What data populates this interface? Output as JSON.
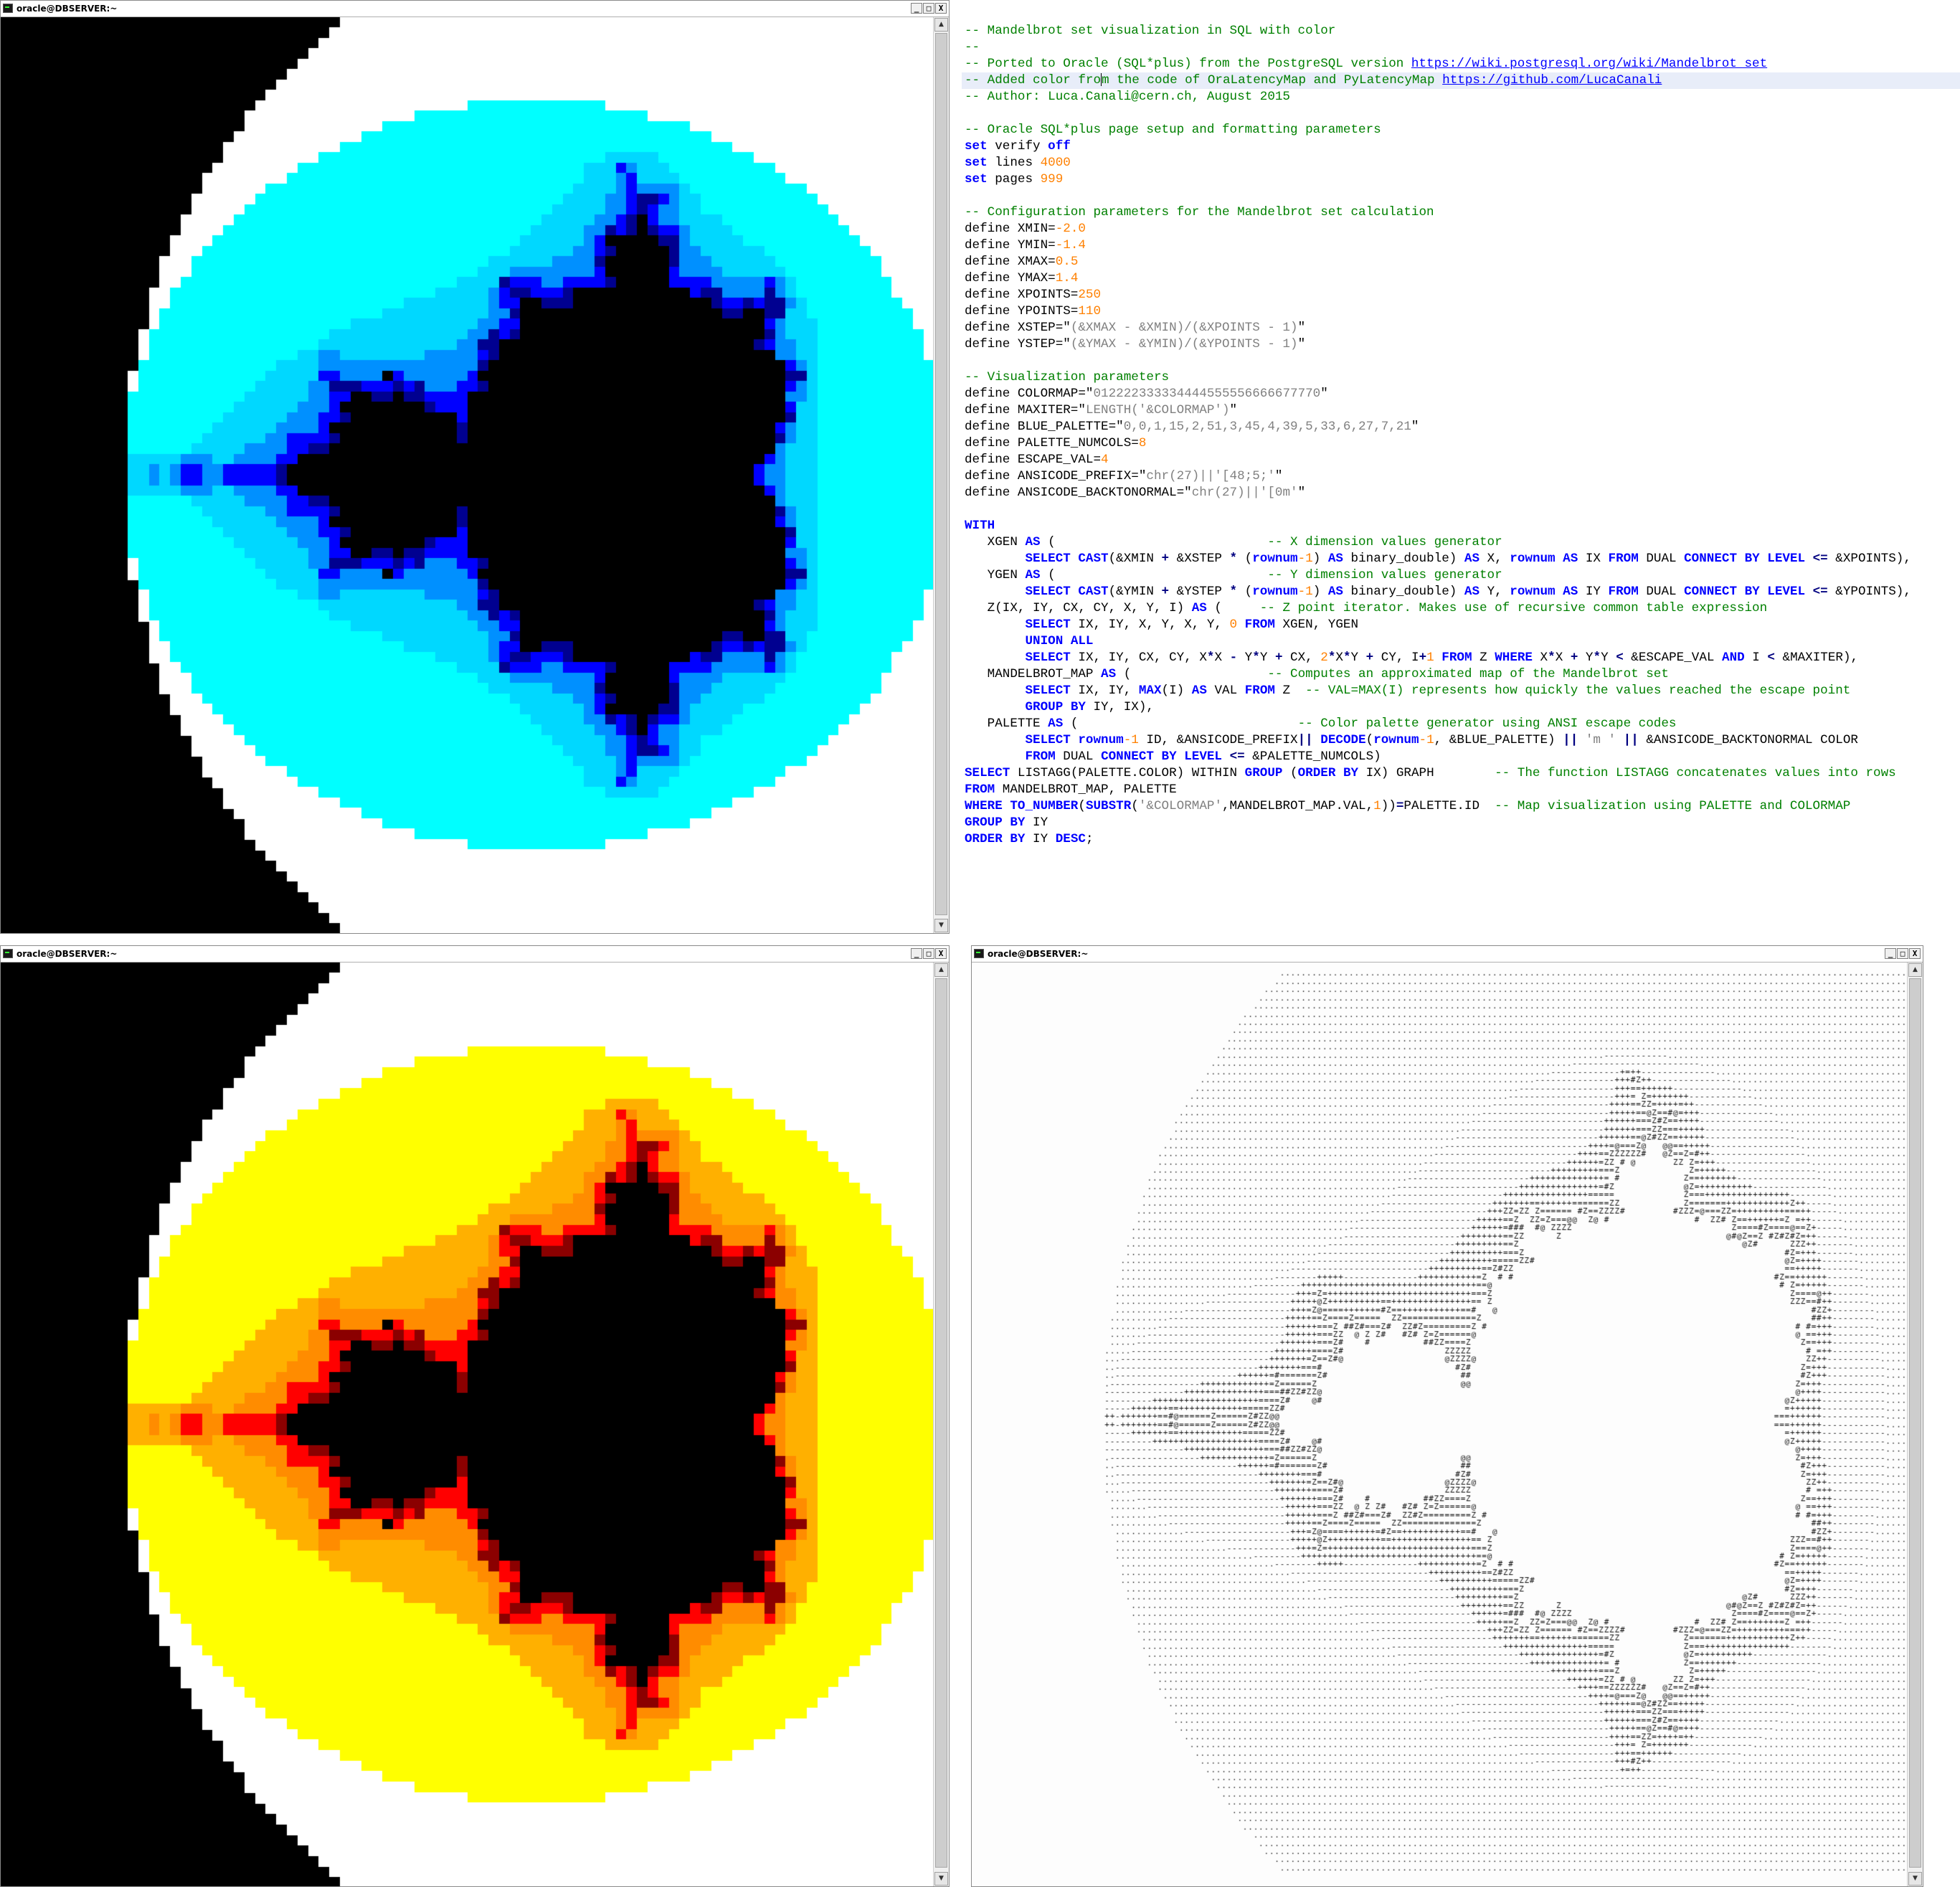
{
  "windows": {
    "blue": {
      "title": "oracle@DBSERVER:~",
      "palette": {
        "colors": [
          "#000000",
          "#000090",
          "#0000ff",
          "#0090ff",
          "#00d8ff",
          "#00ffff",
          "#ffffff"
        ]
      }
    },
    "yellow": {
      "title": "oracle@DBSERVER:~",
      "palette": {
        "colors": [
          "#000000",
          "#8b0000",
          "#ff0000",
          "#ff8c00",
          "#ffb000",
          "#ffff00",
          "#ffffff"
        ]
      }
    },
    "ascii": {
      "title": "oracle@DBSERVER:~",
      "chars": ".-+=Z#@ "
    }
  },
  "window_buttons": {
    "minimize": "_",
    "maximize": "□",
    "close": "X"
  },
  "editor": {
    "lines": [
      [
        {
          "c": "cmt",
          "t": "-- Mandelbrot set visualization in SQL with color"
        }
      ],
      [
        {
          "c": "cmt",
          "t": "--"
        }
      ],
      [
        {
          "c": "cmt",
          "t": "-- Ported to Oracle (SQL*plus) from the PostgreSQL version "
        },
        {
          "c": "url",
          "t": "https://wiki.postgresql.org/wiki/Mandelbrot_set"
        }
      ],
      [
        {
          "c": "cmt",
          "t": "-- Added color fro"
        },
        {
          "c": "caret",
          "t": ""
        },
        {
          "c": "cmt",
          "t": "m the code of OraLatencyMap and PyLatencyMap "
        },
        {
          "c": "url",
          "t": "https://github.com/LucaCanali"
        }
      ],
      [
        {
          "c": "cmt",
          "t": "-- Author: Luca.Canali@cern.ch, August 2015"
        }
      ],
      [],
      [
        {
          "c": "cmt",
          "t": "-- Oracle SQL*plus page setup and formatting parameters"
        }
      ],
      [
        {
          "c": "kw",
          "t": "set"
        },
        {
          "c": "",
          "t": " verify "
        },
        {
          "c": "kw",
          "t": "off"
        }
      ],
      [
        {
          "c": "kw",
          "t": "set"
        },
        {
          "c": "",
          "t": " lines "
        },
        {
          "c": "num",
          "t": "4000"
        }
      ],
      [
        {
          "c": "kw",
          "t": "set"
        },
        {
          "c": "",
          "t": " pages "
        },
        {
          "c": "num",
          "t": "999"
        }
      ],
      [],
      [
        {
          "c": "cmt",
          "t": "-- Configuration parameters for the Mandelbrot set calculation"
        }
      ],
      [
        {
          "c": "",
          "t": "define XMIN="
        },
        {
          "c": "num",
          "t": "-2.0"
        }
      ],
      [
        {
          "c": "",
          "t": "define YMIN="
        },
        {
          "c": "num",
          "t": "-1.4"
        }
      ],
      [
        {
          "c": "",
          "t": "define XMAX="
        },
        {
          "c": "num",
          "t": "0.5"
        }
      ],
      [
        {
          "c": "",
          "t": "define YMAX="
        },
        {
          "c": "num",
          "t": "1.4"
        }
      ],
      [
        {
          "c": "",
          "t": "define XPOINTS="
        },
        {
          "c": "num",
          "t": "250"
        }
      ],
      [
        {
          "c": "",
          "t": "define YPOINTS="
        },
        {
          "c": "num",
          "t": "110"
        }
      ],
      [
        {
          "c": "",
          "t": "define XSTEP=\""
        },
        {
          "c": "str",
          "t": "(&XMAX - &XMIN)/(&XPOINTS - 1)"
        },
        {
          "c": "",
          "t": "\""
        }
      ],
      [
        {
          "c": "",
          "t": "define YSTEP=\""
        },
        {
          "c": "str",
          "t": "(&YMAX - &YMIN)/(&YPOINTS - 1)"
        },
        {
          "c": "",
          "t": "\""
        }
      ],
      [],
      [
        {
          "c": "cmt",
          "t": "-- Visualization parameters"
        }
      ],
      [
        {
          "c": "",
          "t": "define COLORMAP=\""
        },
        {
          "c": "str",
          "t": "012222333334444555556666677770"
        },
        {
          "c": "",
          "t": "\""
        }
      ],
      [
        {
          "c": "",
          "t": "define MAXITER=\""
        },
        {
          "c": "str",
          "t": "LENGTH('&COLORMAP')"
        },
        {
          "c": "",
          "t": "\""
        }
      ],
      [
        {
          "c": "",
          "t": "define BLUE_PALETTE=\""
        },
        {
          "c": "str",
          "t": "0,0,1,15,2,51,3,45,4,39,5,33,6,27,7,21"
        },
        {
          "c": "",
          "t": "\""
        }
      ],
      [
        {
          "c": "",
          "t": "define PALETTE_NUMCOLS="
        },
        {
          "c": "num",
          "t": "8"
        }
      ],
      [
        {
          "c": "",
          "t": "define ESCAPE_VAL="
        },
        {
          "c": "num",
          "t": "4"
        }
      ],
      [
        {
          "c": "",
          "t": "define ANSICODE_PREFIX=\""
        },
        {
          "c": "str",
          "t": "chr(27)||'[48;5;'"
        },
        {
          "c": "",
          "t": "\""
        }
      ],
      [
        {
          "c": "",
          "t": "define ANSICODE_BACKTONORMAL=\""
        },
        {
          "c": "str",
          "t": "chr(27)||'[0m'"
        },
        {
          "c": "",
          "t": "\""
        }
      ],
      [],
      [
        {
          "c": "kw",
          "t": "WITH"
        }
      ],
      [
        {
          "c": "",
          "t": "   XGEN "
        },
        {
          "c": "kw",
          "t": "AS"
        },
        {
          "c": "",
          "t": " (                            "
        },
        {
          "c": "cmt",
          "t": "-- X dimension values generator"
        }
      ],
      [
        {
          "c": "",
          "t": "        "
        },
        {
          "c": "kw",
          "t": "SELECT CAST"
        },
        {
          "c": "",
          "t": "(&XMIN "
        },
        {
          "c": "op",
          "t": "+"
        },
        {
          "c": "",
          "t": " &XSTEP "
        },
        {
          "c": "op",
          "t": "*"
        },
        {
          "c": "",
          "t": " ("
        },
        {
          "c": "kw",
          "t": "rownum"
        },
        {
          "c": "num",
          "t": "-1"
        },
        {
          "c": "",
          "t": ") "
        },
        {
          "c": "kw",
          "t": "AS"
        },
        {
          "c": "",
          "t": " binary_double) "
        },
        {
          "c": "kw",
          "t": "AS"
        },
        {
          "c": "",
          "t": " X, "
        },
        {
          "c": "kw",
          "t": "rownum AS"
        },
        {
          "c": "",
          "t": " IX "
        },
        {
          "c": "kw",
          "t": "FROM"
        },
        {
          "c": "",
          "t": " DUAL "
        },
        {
          "c": "kw",
          "t": "CONNECT BY LEVEL"
        },
        {
          "c": "",
          "t": " "
        },
        {
          "c": "op",
          "t": "<="
        },
        {
          "c": "",
          "t": " &XPOINTS),"
        }
      ],
      [
        {
          "c": "",
          "t": "   YGEN "
        },
        {
          "c": "kw",
          "t": "AS"
        },
        {
          "c": "",
          "t": " (                            "
        },
        {
          "c": "cmt",
          "t": "-- Y dimension values generator"
        }
      ],
      [
        {
          "c": "",
          "t": "        "
        },
        {
          "c": "kw",
          "t": "SELECT CAST"
        },
        {
          "c": "",
          "t": "(&YMIN "
        },
        {
          "c": "op",
          "t": "+"
        },
        {
          "c": "",
          "t": " &YSTEP "
        },
        {
          "c": "op",
          "t": "*"
        },
        {
          "c": "",
          "t": " ("
        },
        {
          "c": "kw",
          "t": "rownum"
        },
        {
          "c": "num",
          "t": "-1"
        },
        {
          "c": "",
          "t": ") "
        },
        {
          "c": "kw",
          "t": "AS"
        },
        {
          "c": "",
          "t": " binary_double) "
        },
        {
          "c": "kw",
          "t": "AS"
        },
        {
          "c": "",
          "t": " Y, "
        },
        {
          "c": "kw",
          "t": "rownum AS"
        },
        {
          "c": "",
          "t": " IY "
        },
        {
          "c": "kw",
          "t": "FROM"
        },
        {
          "c": "",
          "t": " DUAL "
        },
        {
          "c": "kw",
          "t": "CONNECT BY LEVEL"
        },
        {
          "c": "",
          "t": " "
        },
        {
          "c": "op",
          "t": "<="
        },
        {
          "c": "",
          "t": " &YPOINTS),"
        }
      ],
      [
        {
          "c": "",
          "t": "   Z(IX, IY, CX, CY, X, Y, I) "
        },
        {
          "c": "kw",
          "t": "AS"
        },
        {
          "c": "",
          "t": " (     "
        },
        {
          "c": "cmt",
          "t": "-- Z point iterator. Makes use of recursive common table expression"
        }
      ],
      [
        {
          "c": "",
          "t": "        "
        },
        {
          "c": "kw",
          "t": "SELECT"
        },
        {
          "c": "",
          "t": " IX, IY, X, Y, X, Y, "
        },
        {
          "c": "num",
          "t": "0"
        },
        {
          "c": "",
          "t": " "
        },
        {
          "c": "kw",
          "t": "FROM"
        },
        {
          "c": "",
          "t": " XGEN, YGEN"
        }
      ],
      [
        {
          "c": "",
          "t": "        "
        },
        {
          "c": "kw",
          "t": "UNION ALL"
        }
      ],
      [
        {
          "c": "",
          "t": "        "
        },
        {
          "c": "kw",
          "t": "SELECT"
        },
        {
          "c": "",
          "t": " IX, IY, CX, CY, X"
        },
        {
          "c": "op",
          "t": "*"
        },
        {
          "c": "",
          "t": "X "
        },
        {
          "c": "op",
          "t": "-"
        },
        {
          "c": "",
          "t": " Y"
        },
        {
          "c": "op",
          "t": "*"
        },
        {
          "c": "",
          "t": "Y "
        },
        {
          "c": "op",
          "t": "+"
        },
        {
          "c": "",
          "t": " CX, "
        },
        {
          "c": "num",
          "t": "2"
        },
        {
          "c": "op",
          "t": "*"
        },
        {
          "c": "",
          "t": "X"
        },
        {
          "c": "op",
          "t": "*"
        },
        {
          "c": "",
          "t": "Y "
        },
        {
          "c": "op",
          "t": "+"
        },
        {
          "c": "",
          "t": " CY, I"
        },
        {
          "c": "op",
          "t": "+"
        },
        {
          "c": "num",
          "t": "1"
        },
        {
          "c": "",
          "t": " "
        },
        {
          "c": "kw",
          "t": "FROM"
        },
        {
          "c": "",
          "t": " Z "
        },
        {
          "c": "kw",
          "t": "WHERE"
        },
        {
          "c": "",
          "t": " X"
        },
        {
          "c": "op",
          "t": "*"
        },
        {
          "c": "",
          "t": "X "
        },
        {
          "c": "op",
          "t": "+"
        },
        {
          "c": "",
          "t": " Y"
        },
        {
          "c": "op",
          "t": "*"
        },
        {
          "c": "",
          "t": "Y "
        },
        {
          "c": "op",
          "t": "<"
        },
        {
          "c": "",
          "t": " &ESCAPE_VAL "
        },
        {
          "c": "kw",
          "t": "AND"
        },
        {
          "c": "",
          "t": " I "
        },
        {
          "c": "op",
          "t": "<"
        },
        {
          "c": "",
          "t": " &MAXITER),"
        }
      ],
      [
        {
          "c": "",
          "t": "   MANDELBROT_MAP "
        },
        {
          "c": "kw",
          "t": "AS"
        },
        {
          "c": "",
          "t": " (                  "
        },
        {
          "c": "cmt",
          "t": "-- Computes an approximated map of the Mandelbrot set"
        }
      ],
      [
        {
          "c": "",
          "t": "        "
        },
        {
          "c": "kw",
          "t": "SELECT"
        },
        {
          "c": "",
          "t": " IX, IY, "
        },
        {
          "c": "kw",
          "t": "MAX"
        },
        {
          "c": "",
          "t": "(I) "
        },
        {
          "c": "kw",
          "t": "AS"
        },
        {
          "c": "",
          "t": " VAL "
        },
        {
          "c": "kw",
          "t": "FROM"
        },
        {
          "c": "",
          "t": " Z  "
        },
        {
          "c": "cmt",
          "t": "-- VAL=MAX(I) represents how quickly the values reached the escape point"
        }
      ],
      [
        {
          "c": "",
          "t": "        "
        },
        {
          "c": "kw",
          "t": "GROUP BY"
        },
        {
          "c": "",
          "t": " IY, IX),"
        }
      ],
      [
        {
          "c": "",
          "t": "   PALETTE "
        },
        {
          "c": "kw",
          "t": "AS"
        },
        {
          "c": "",
          "t": " (                             "
        },
        {
          "c": "cmt",
          "t": "-- Color palette generator using ANSI escape codes"
        }
      ],
      [
        {
          "c": "",
          "t": "        "
        },
        {
          "c": "kw",
          "t": "SELECT rownum"
        },
        {
          "c": "num",
          "t": "-1"
        },
        {
          "c": "",
          "t": " ID, &ANSICODE_PREFIX"
        },
        {
          "c": "op",
          "t": "||"
        },
        {
          "c": "",
          "t": " "
        },
        {
          "c": "kw",
          "t": "DECODE"
        },
        {
          "c": "",
          "t": "("
        },
        {
          "c": "kw",
          "t": "rownum"
        },
        {
          "c": "num",
          "t": "-1"
        },
        {
          "c": "",
          "t": ", &BLUE_PALETTE) "
        },
        {
          "c": "op",
          "t": "||"
        },
        {
          "c": "",
          "t": " "
        },
        {
          "c": "str",
          "t": "'m '"
        },
        {
          "c": "",
          "t": " "
        },
        {
          "c": "op",
          "t": "||"
        },
        {
          "c": "",
          "t": " &ANSICODE_BACKTONORMAL COLOR"
        }
      ],
      [
        {
          "c": "",
          "t": "        "
        },
        {
          "c": "kw",
          "t": "FROM"
        },
        {
          "c": "",
          "t": " DUAL "
        },
        {
          "c": "kw",
          "t": "CONNECT BY LEVEL"
        },
        {
          "c": "",
          "t": " "
        },
        {
          "c": "op",
          "t": "<="
        },
        {
          "c": "",
          "t": " &PALETTE_NUMCOLS)"
        }
      ],
      [
        {
          "c": "kw",
          "t": "SELECT"
        },
        {
          "c": "",
          "t": " LISTAGG(PALETTE.COLOR) WITHIN "
        },
        {
          "c": "kw",
          "t": "GROUP"
        },
        {
          "c": "",
          "t": " ("
        },
        {
          "c": "kw",
          "t": "ORDER BY"
        },
        {
          "c": "",
          "t": " IX) GRAPH        "
        },
        {
          "c": "cmt",
          "t": "-- The function LISTAGG concatenates values into rows"
        }
      ],
      [
        {
          "c": "kw",
          "t": "FROM"
        },
        {
          "c": "",
          "t": " MANDELBROT_MAP, PALETTE"
        }
      ],
      [
        {
          "c": "kw",
          "t": "WHERE TO_NUMBER"
        },
        {
          "c": "",
          "t": "("
        },
        {
          "c": "kw",
          "t": "SUBSTR"
        },
        {
          "c": "",
          "t": "("
        },
        {
          "c": "str",
          "t": "'&COLORMAP'"
        },
        {
          "c": "",
          "t": ",MANDELBROT_MAP.VAL,"
        },
        {
          "c": "num",
          "t": "1"
        },
        {
          "c": "",
          "t": "))"
        },
        {
          "c": "op",
          "t": "="
        },
        {
          "c": "",
          "t": "PALETTE.ID  "
        },
        {
          "c": "cmt",
          "t": "-- Map visualization using PALETTE and COLORMAP"
        }
      ],
      [
        {
          "c": "kw",
          "t": "GROUP BY"
        },
        {
          "c": "",
          "t": " IY"
        }
      ],
      [
        {
          "c": "kw",
          "t": "ORDER BY"
        },
        {
          "c": "",
          "t": " IY "
        },
        {
          "c": "kw",
          "t": "DESC"
        },
        {
          "c": "",
          "t": ";"
        }
      ]
    ]
  }
}
